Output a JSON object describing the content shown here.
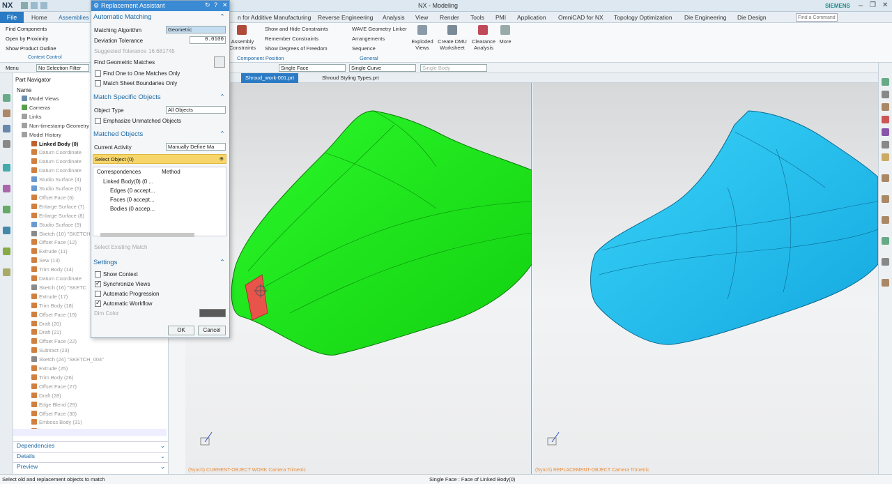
{
  "title_bar": {
    "logo": "NX",
    "window_title": "NX - Modeling",
    "brand": "SIEMENS"
  },
  "menu": {
    "file": "File",
    "home": "Home",
    "assemblies": "Assemblies",
    "items": [
      "n for Additive Manufacturing",
      "Reverse Engineering",
      "Analysis",
      "View",
      "Render",
      "Tools",
      "PMI",
      "Application",
      "OmniCAD for NX",
      "Topology Optimization",
      "Die Engineering",
      "Die Design"
    ],
    "search_placeholder": "Find a Command"
  },
  "ribbon": {
    "left_items": [
      "Find Components",
      "Open by Proximity",
      "Show Product Outline"
    ],
    "context_control": "Context Control",
    "assembly_constraints": "Assembly Constraints",
    "constraint_items": [
      "Show and Hide Constraints",
      "Remember Constraints",
      "Show Degrees of Freedom"
    ],
    "component_position": "Component Position",
    "general_items": [
      "WAVE Geometry Linker",
      "Arrangements",
      "Sequence"
    ],
    "general": "General",
    "big_buttons": [
      "Exploded Views",
      "Create DMU Worksheet",
      "Clearance Analysis",
      "More"
    ]
  },
  "selection_bar": {
    "menu": "Menu",
    "filter": "No Selection Filter",
    "face_rule": "Single Face",
    "curve_rule": "Single Curve",
    "body_rule": "Single Body"
  },
  "tabs": [
    "Shroud_work-001.prt",
    "Shroud Styling Types.prt"
  ],
  "navigator": {
    "title": "Part Navigator",
    "column": "Name",
    "rows": [
      {
        "label": "Model Views",
        "color": "#6a8cab",
        "bold": false,
        "dim": false,
        "indent": 0
      },
      {
        "label": "Cameras",
        "color": "#5aa04a",
        "bold": false,
        "dim": false,
        "indent": 0
      },
      {
        "label": "Links",
        "color": "#a0a0a0",
        "bold": false,
        "dim": false,
        "indent": 0
      },
      {
        "label": "Non-timestamp Geometry",
        "color": "#a0a0a0",
        "bold": false,
        "dim": false,
        "indent": 0
      },
      {
        "label": "Model History",
        "color": "#a0a0a0",
        "bold": false,
        "dim": false,
        "indent": 0
      },
      {
        "label": "Linked Body (0)",
        "color": "#c06030",
        "bold": true,
        "dim": false,
        "indent": 1
      },
      {
        "label": "Datum Coordinate",
        "color": "#d08040",
        "bold": false,
        "dim": true,
        "indent": 1
      },
      {
        "label": "Datum Coordinate",
        "color": "#d08040",
        "bold": false,
        "dim": true,
        "indent": 1
      },
      {
        "label": "Datum Coordinate",
        "color": "#d08040",
        "bold": false,
        "dim": true,
        "indent": 1
      },
      {
        "label": "Studio Surface (4)",
        "color": "#6a9ad0",
        "bold": false,
        "dim": true,
        "indent": 1
      },
      {
        "label": "Studio Surface (5)",
        "color": "#6a9ad0",
        "bold": false,
        "dim": true,
        "indent": 1
      },
      {
        "label": "Offset Face (6)",
        "color": "#d08040",
        "bold": false,
        "dim": true,
        "indent": 1
      },
      {
        "label": "Enlarge Surface (7)",
        "color": "#d08040",
        "bold": false,
        "dim": true,
        "indent": 1
      },
      {
        "label": "Enlarge Surface (8)",
        "color": "#d08040",
        "bold": false,
        "dim": true,
        "indent": 1
      },
      {
        "label": "Studio Surface (9)",
        "color": "#6a9ad0",
        "bold": false,
        "dim": true,
        "indent": 1
      },
      {
        "label": "Sketch (10) \"SKETCH",
        "color": "#8a8a8a",
        "bold": false,
        "dim": true,
        "indent": 1
      },
      {
        "label": "Offset Face (12)",
        "color": "#d08040",
        "bold": false,
        "dim": true,
        "indent": 1
      },
      {
        "label": "Extrude (11)",
        "color": "#d08040",
        "bold": false,
        "dim": true,
        "indent": 1
      },
      {
        "label": "Sew (13)",
        "color": "#d08040",
        "bold": false,
        "dim": true,
        "indent": 1
      },
      {
        "label": "Trim Body (14)",
        "color": "#d08040",
        "bold": false,
        "dim": true,
        "indent": 1
      },
      {
        "label": "Datum Coordinate",
        "color": "#d08040",
        "bold": false,
        "dim": true,
        "indent": 1
      },
      {
        "label": "Sketch (16) \"SKETC",
        "color": "#8a8a8a",
        "bold": false,
        "dim": true,
        "indent": 1
      },
      {
        "label": "Extrude (17)",
        "color": "#d08040",
        "bold": false,
        "dim": true,
        "indent": 1
      },
      {
        "label": "Trim Body (18)",
        "color": "#d08040",
        "bold": false,
        "dim": true,
        "indent": 1
      },
      {
        "label": "Offset Face (19)",
        "color": "#d08040",
        "bold": false,
        "dim": true,
        "indent": 1
      },
      {
        "label": "Draft (20)",
        "color": "#d08040",
        "bold": false,
        "dim": true,
        "indent": 1
      },
      {
        "label": "Draft (21)",
        "color": "#d08040",
        "bold": false,
        "dim": true,
        "indent": 1
      },
      {
        "label": "Offset Face (22)",
        "color": "#d08040",
        "bold": false,
        "dim": true,
        "indent": 1
      },
      {
        "label": "Subtract (23)",
        "color": "#d08040",
        "bold": false,
        "dim": true,
        "indent": 1
      },
      {
        "label": "Sketch (24) \"SKETCH_004\"",
        "color": "#8a8a8a",
        "bold": false,
        "dim": true,
        "indent": 1
      },
      {
        "label": "Extrude (25)",
        "color": "#d08040",
        "bold": false,
        "dim": true,
        "indent": 1
      },
      {
        "label": "Trim Body (26)",
        "color": "#d08040",
        "bold": false,
        "dim": true,
        "indent": 1
      },
      {
        "label": "Offset Face (27)",
        "color": "#d08040",
        "bold": false,
        "dim": true,
        "indent": 1
      },
      {
        "label": "Draft (28)",
        "color": "#d08040",
        "bold": false,
        "dim": true,
        "indent": 1
      },
      {
        "label": "Edge Blend (29)",
        "color": "#d08040",
        "bold": false,
        "dim": true,
        "indent": 1
      },
      {
        "label": "Offset Face (30)",
        "color": "#d08040",
        "bold": false,
        "dim": true,
        "indent": 1
      },
      {
        "label": "Emboss Body (31)",
        "color": "#d08040",
        "bold": false,
        "dim": true,
        "indent": 1
      },
      {
        "label": "Emboss Body (32)",
        "color": "#d08040",
        "bold": false,
        "dim": true,
        "indent": 1
      }
    ],
    "panels": [
      "Dependencies",
      "Details",
      "Preview"
    ]
  },
  "dialog": {
    "title": "Replacement Assistant",
    "section_auto": "Automatic Matching",
    "matching_algorithm_label": "Matching Algorithm",
    "matching_algorithm": "Geometric",
    "deviation_label": "Deviation Tolerance",
    "deviation": "0.0100",
    "suggested_label": "Suggested Tolerance",
    "suggested": "16.681745",
    "find_geo": "Find Geometric Matches",
    "one_to_one": "Find One to One Matches Only",
    "sheet_bounds": "Match Sheet Boundaries Only",
    "section_specific": "Match Specific Objects",
    "object_type_label": "Object Type",
    "object_type": "All Objects",
    "emphasize": "Emphasize Unmatched Objects",
    "section_matched": "Matched Objects",
    "current_activity_label": "Current Activity",
    "current_activity": "Manually Define Ma",
    "select_object": "Select Object (0)",
    "col_correspondences": "Correspondences",
    "col_method": "Method",
    "tree": [
      "Linked Body(0) (0 ...",
      "Edges (0 accept...",
      "Faces (0 accept...",
      "Bodies (0 accep..."
    ],
    "select_existing": "Select Existing Match",
    "section_settings": "Settings",
    "show_context": "Show Context",
    "sync_views": "Synchronize Views",
    "auto_progression": "Automatic Progression",
    "auto_workflow": "Automatic Workflow",
    "dim_color": "Dim Color",
    "ok": "OK",
    "cancel": "Cancel"
  },
  "viewports": {
    "left_label": "(Synch) CURRENT-OBJECT WORK Camera Trimetric",
    "right_label": "(Synch) REPLACEMENT-OBJECT Camera Trimetric",
    "left_color": "#1ef21a",
    "right_color": "#19c5f2",
    "highlight_color": "#e8534a"
  },
  "status": {
    "left": "Select old and replacement objects to match",
    "center": "Single Face : Face of Linked Body(0)"
  }
}
